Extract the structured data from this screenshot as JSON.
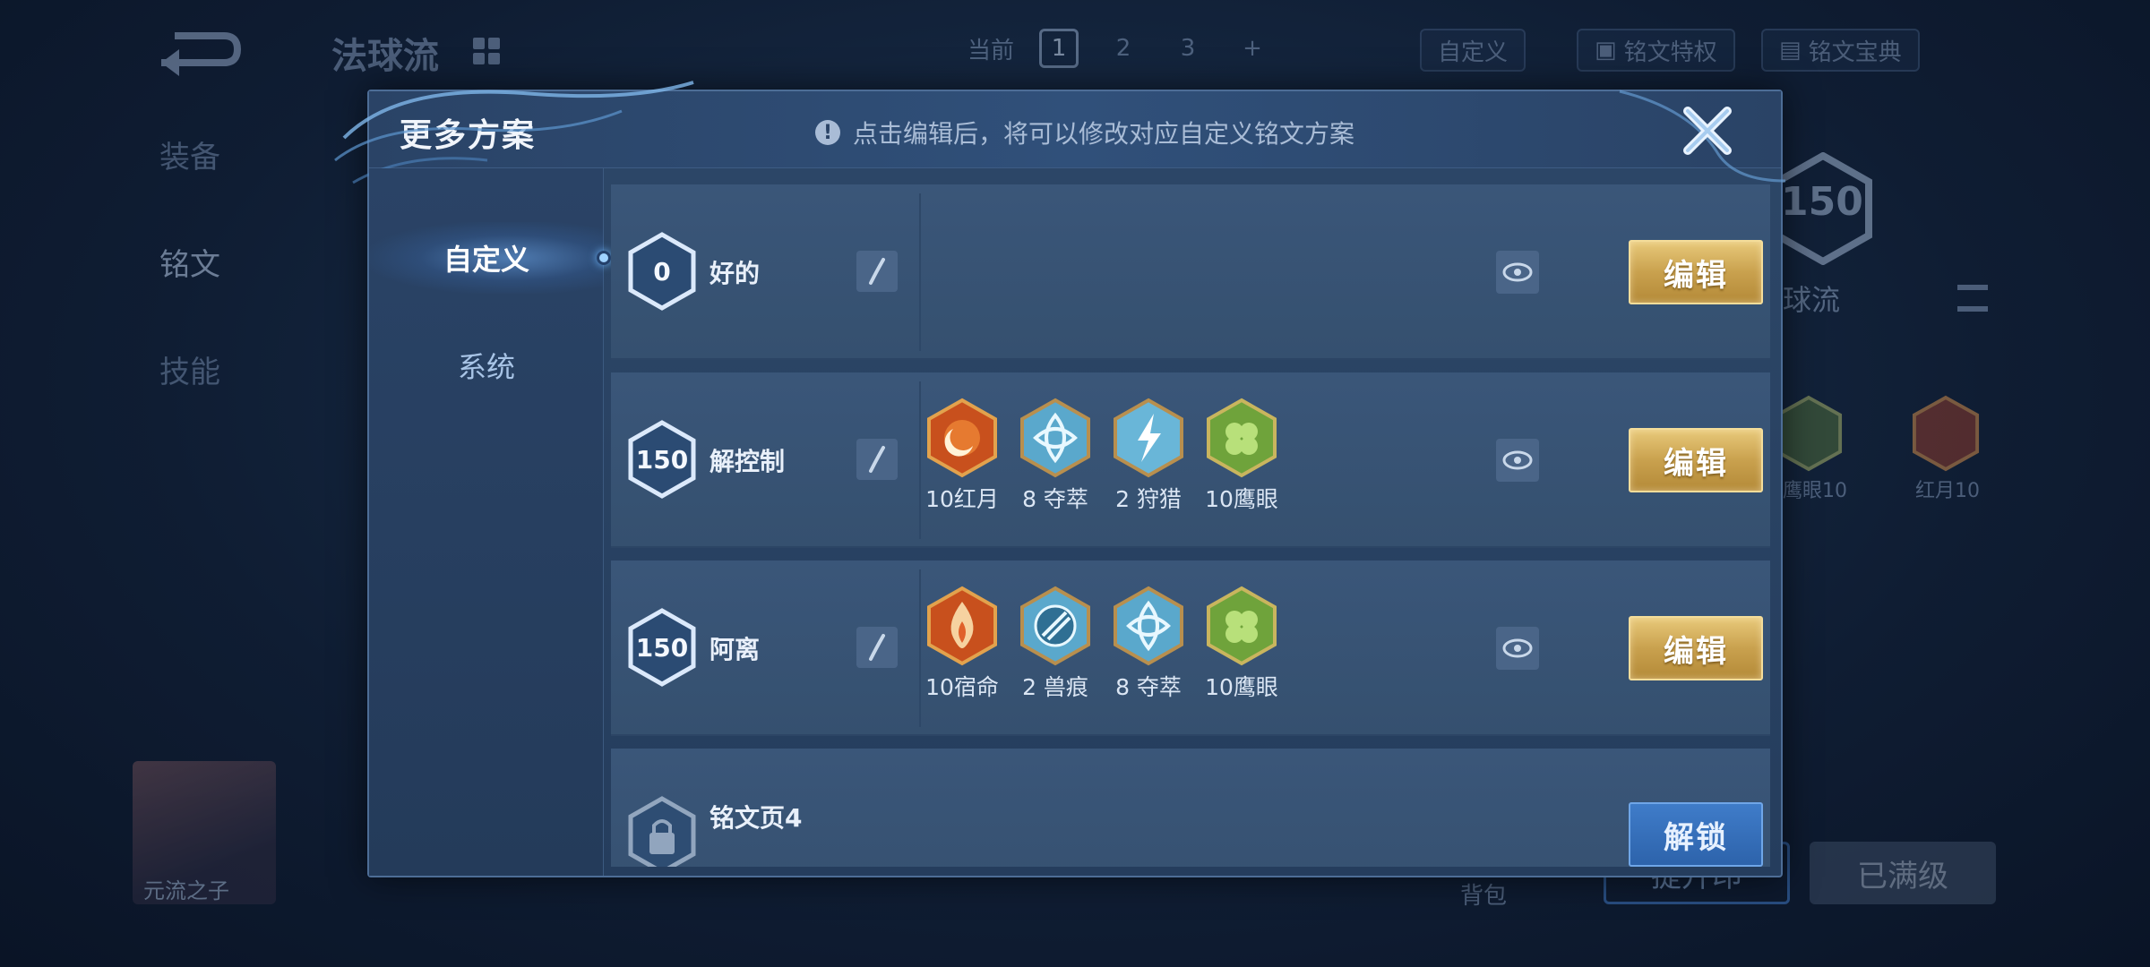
{
  "background": {
    "title": "法球流",
    "top_tabs": {
      "current_label": "当前",
      "pages": [
        "1",
        "2",
        "3"
      ],
      "add_label": "+"
    },
    "custom_label": "自定义",
    "feature_label": "铭文特权",
    "codex_label": "铭文宝典",
    "side_items": [
      "装备",
      "铭文",
      "技能"
    ],
    "level_number": "150",
    "plan_name_partial": "球流",
    "rune_partial_label": "鹰眼10",
    "rune_right_label": "红月10",
    "hero_name": "元流之子",
    "bag_label": "背包",
    "upgrade_label": "提升印",
    "maxed_label": "已满级"
  },
  "modal": {
    "title": "更多方案",
    "notice": "点击编辑后，将可以修改对应自定义铭文方案",
    "notice_icon": "info-icon",
    "tabs": [
      {
        "label": "自定义",
        "active": true
      },
      {
        "label": "系统",
        "active": false
      }
    ],
    "rows": [
      {
        "level": "0",
        "name": "好的",
        "runes": [],
        "action": "编辑",
        "locked": false
      },
      {
        "level": "150",
        "name": "解控制",
        "action": "编辑",
        "locked": false,
        "runes": [
          {
            "label": "10红月",
            "icon": "red-moon-rune"
          },
          {
            "label": "8 夺萃",
            "icon": "blue-knot-rune"
          },
          {
            "label": "2 狩猎",
            "icon": "blue-lightning-rune"
          },
          {
            "label": "10鹰眼",
            "icon": "green-hawk-rune"
          }
        ]
      },
      {
        "level": "150",
        "name": "阿离",
        "action": "编辑",
        "locked": false,
        "runes": [
          {
            "label": "10宿命",
            "icon": "red-flame-rune"
          },
          {
            "label": "2 兽痕",
            "icon": "blue-claw-rune"
          },
          {
            "label": "8 夺萃",
            "icon": "blue-knot-rune"
          },
          {
            "label": "10鹰眼",
            "icon": "green-hawk-rune"
          }
        ]
      },
      {
        "level": "",
        "name": "铭文页4",
        "runes": [],
        "action": "解锁",
        "locked": true
      }
    ]
  },
  "colors": {
    "gold_button": "#c9a14e",
    "blue_button": "#2d63ab",
    "panel": "#2d4768"
  }
}
